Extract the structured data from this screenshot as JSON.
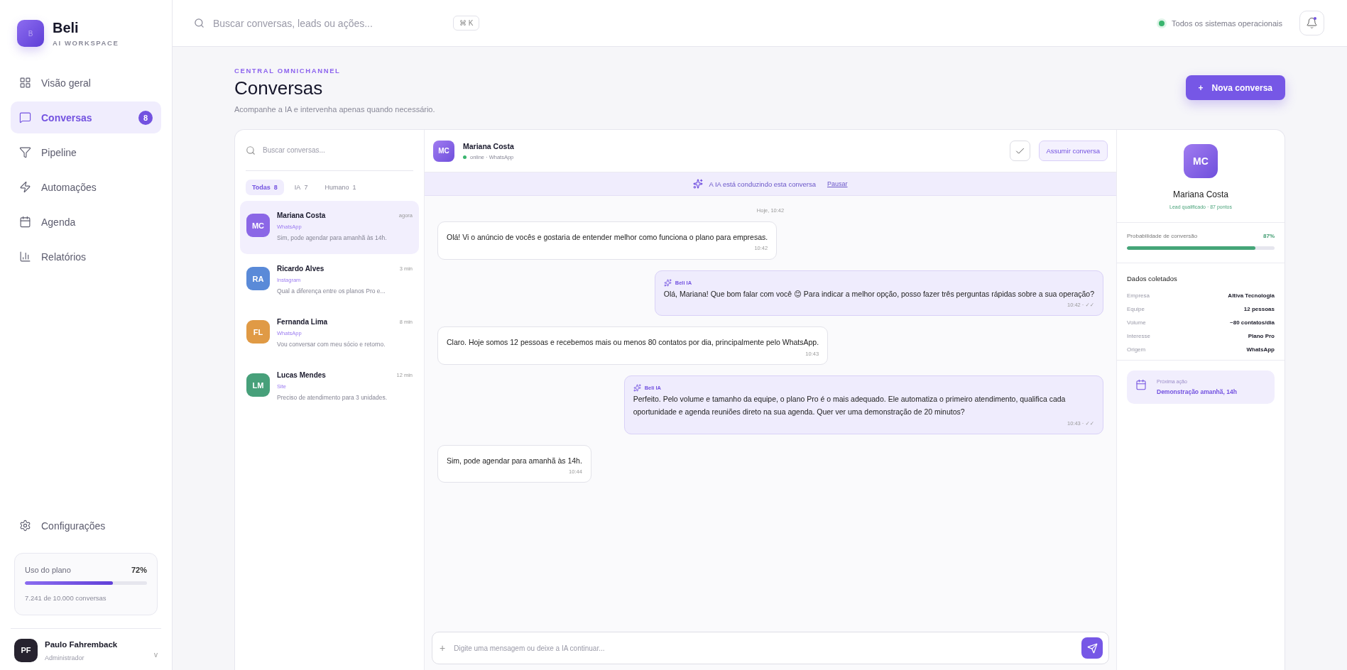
{
  "sidebar": {
    "logo_letter": "B",
    "brand": "Beli",
    "subtitle": "AI WORKSPACE",
    "nav": [
      {
        "label": "Visão geral",
        "selected": false
      },
      {
        "label": "Conversas",
        "selected": true,
        "badge": "8"
      },
      {
        "label": "Pipeline",
        "selected": false
      },
      {
        "label": "Automações",
        "selected": false
      },
      {
        "label": "Agenda",
        "selected": false
      },
      {
        "label": "Relatórios",
        "selected": false
      }
    ],
    "settings": "Configurações",
    "plan": {
      "label": "Uso do plano",
      "percent": "72%",
      "level": 0.72,
      "detail": "7.241 de 10.000 conversas"
    },
    "user": {
      "initials": "PF",
      "name": "Paulo Fahremback",
      "role": "Administrador",
      "chevron": "v"
    }
  },
  "topbar": {
    "search": {
      "placeholder": "Buscar conversas, leads ou ações..."
    },
    "shortcut": "⌘ K",
    "status": "Todos os sistemas operacionais"
  },
  "page": {
    "eyebrow": "CENTRAL OMNICHANNEL",
    "title": "Conversas",
    "subtitle": "Acompanhe a IA e intervenha apenas quando necessário.",
    "new_button": {
      "icon": "+",
      "label": "Nova conversa"
    }
  },
  "list": {
    "search": {
      "placeholder": "Buscar conversas..."
    },
    "filters": [
      {
        "label": "Todas",
        "count": "8",
        "selected": true
      },
      {
        "label": "IA",
        "count": "7",
        "selected": false
      },
      {
        "label": "Humano",
        "count": "1",
        "selected": false
      }
    ],
    "items": [
      {
        "initials": "MC",
        "name": "Mariana Costa",
        "channel": "WhatsApp",
        "preview": "Sim, pode agendar para amanhã às 14h.",
        "time": "agora",
        "color": "#8b67e6",
        "selected": true
      },
      {
        "initials": "RA",
        "name": "Ricardo Alves",
        "channel": "Instagram",
        "preview": "Qual a diferença entre os planos Pro e...",
        "time": "3 min",
        "color": "#5a8ad8",
        "selected": false
      },
      {
        "initials": "FL",
        "name": "Fernanda Lima",
        "channel": "WhatsApp",
        "preview": "Vou conversar com meu sócio e retorno.",
        "time": "8 min",
        "color": "#e09a45",
        "selected": false
      },
      {
        "initials": "LM",
        "name": "Lucas Mendes",
        "channel": "Site",
        "preview": "Preciso de atendimento para 3 unidades.",
        "time": "12 min",
        "color": "#47a07a",
        "selected": false
      }
    ]
  },
  "chat": {
    "contact": {
      "initials": "MC",
      "name": "Mariana Costa",
      "status": "online · WhatsApp"
    },
    "assume_button": "Assumir conversa",
    "banner": {
      "text": "A IA está conduzindo esta conversa",
      "link": "Pausar"
    },
    "day": "Hoje, 10:42",
    "messages": [
      {
        "kind": "lead",
        "text": "Olá! Vi o anúncio de vocês e gostaria de entender melhor como funciona o plano para empresas.",
        "time": "10:42"
      },
      {
        "kind": "ai",
        "sender": "Beli IA",
        "text": "Olá, Mariana! Que bom falar com você 😊 Para indicar a melhor opção, posso fazer três perguntas rápidas sobre a sua operação?",
        "time": "10:42 · ✓✓"
      },
      {
        "kind": "lead",
        "text": "Claro. Hoje somos 12 pessoas e recebemos mais ou menos 80 contatos por dia, principalmente pelo WhatsApp.",
        "time": "10:43"
      },
      {
        "kind": "ai",
        "sender": "Beli IA",
        "text": "Perfeito. Pelo volume e tamanho da equipe, o plano Pro é o mais adequado. Ele automatiza o primeiro atendimento, qualifica cada oportunidade e agenda reuniões direto na sua agenda. Quer ver uma demonstração de 20 minutos?",
        "time": "10:43 · ✓✓"
      },
      {
        "kind": "lead",
        "text": "Sim, pode agendar para amanhã às 14h.",
        "time": "10:44"
      }
    ],
    "composer": {
      "icon": "+",
      "placeholder": "Digite uma mensagem ou deixe a IA continuar..."
    }
  },
  "profile": {
    "initials": "MC",
    "name": "Mariana Costa",
    "tagline": "Lead qualificado · 87 pontos",
    "probability": {
      "label": "Probabilidade de conversão",
      "value": "87%",
      "level": 0.87
    },
    "data_title": "Dados coletados",
    "fields": [
      {
        "label": "Empresa",
        "value": "Altiva Tecnologia"
      },
      {
        "label": "Equipe",
        "value": "12 pessoas"
      },
      {
        "label": "Volume",
        "value": "~80 contatos/dia"
      },
      {
        "label": "Interesse",
        "value": "Plano Pro"
      },
      {
        "label": "Origem",
        "value": "WhatsApp"
      }
    ],
    "next_action": {
      "label": "Próxima ação",
      "value": "Demonstração amanhã, 14h"
    }
  }
}
